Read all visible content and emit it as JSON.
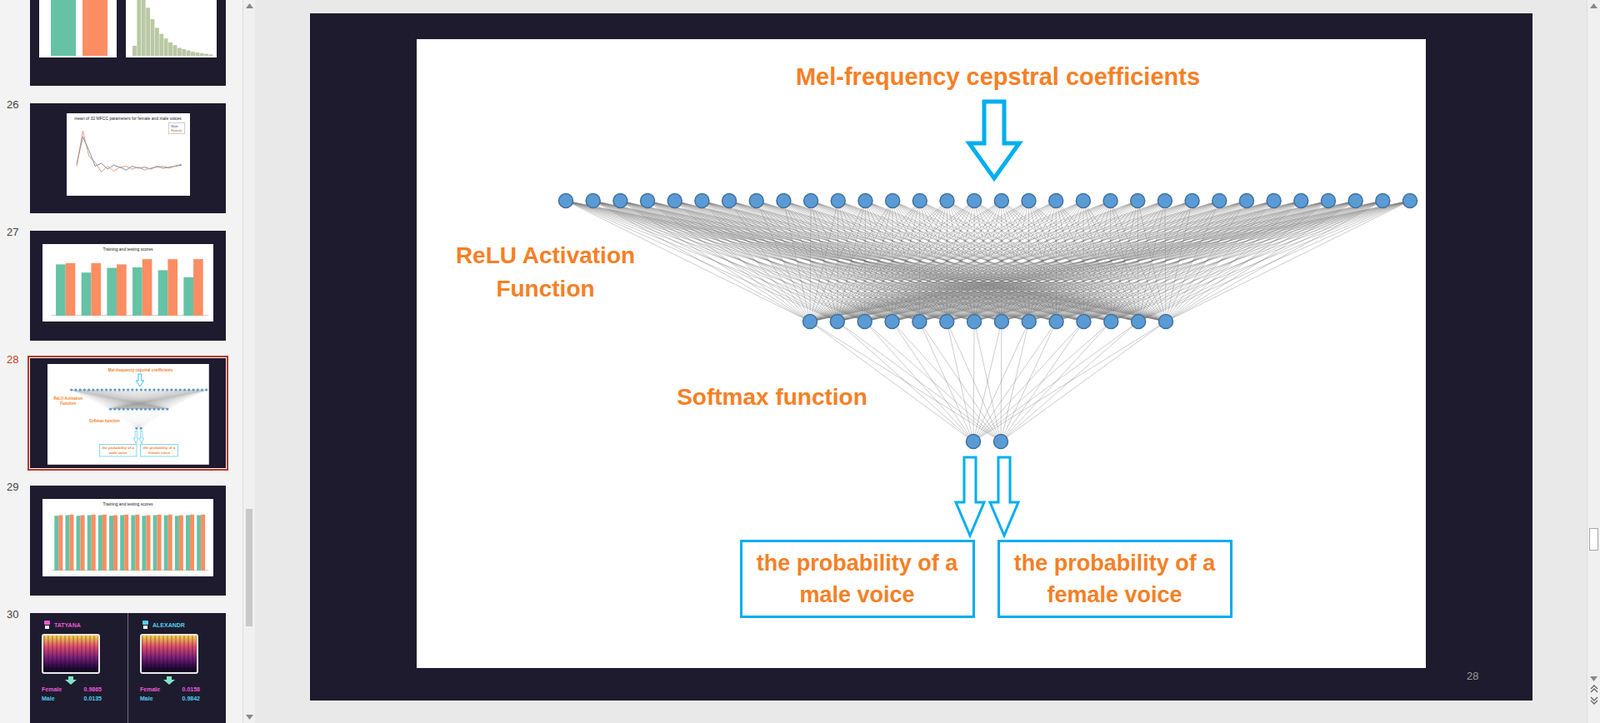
{
  "sidebar": {
    "slides": [
      {
        "number": "",
        "selected": false,
        "kind": "bars-hist",
        "bars": [
          0.95,
          0.92
        ],
        "hist": [
          0.15,
          0.85,
          0.95,
          0.72,
          0.55,
          0.42,
          0.33,
          0.26,
          0.2,
          0.16,
          0.12,
          0.1,
          0.08,
          0.06,
          0.05,
          0.04,
          0.03,
          0.02
        ]
      },
      {
        "number": "26",
        "selected": false,
        "kind": "lines",
        "title": "mean of 32 MFCC parameters for female and male voices",
        "legend": [
          "Male",
          "Female"
        ],
        "series": [
          [
            0.2,
            1.6,
            0.9,
            0.1,
            0.25,
            -0.05,
            0.15,
            0.05,
            -0.1,
            0.1,
            0.0,
            0.05,
            -0.05,
            0.1,
            0.0,
            0.05,
            0.1,
            0.15
          ],
          [
            0.1,
            1.9,
            0.6,
            0.3,
            -0.2,
            0.1,
            -0.15,
            0.05,
            0.1,
            -0.05,
            0.05,
            -0.1,
            0.0,
            0.05,
            0.1,
            0.0,
            0.12,
            0.2
          ]
        ]
      },
      {
        "number": "27",
        "selected": false,
        "kind": "bars",
        "title": "Training and testing scores",
        "series": [
          [
            0.88,
            0.74,
            0.82,
            0.83,
            0.78,
            0.66
          ],
          [
            0.9,
            0.9,
            0.88,
            0.97,
            0.97,
            0.97
          ]
        ]
      },
      {
        "number": "28",
        "selected": true,
        "kind": "diagram"
      },
      {
        "number": "29",
        "selected": false,
        "kind": "bars",
        "title": "Training and testing scores",
        "series": [
          [
            0.94,
            0.95,
            0.94,
            0.95,
            0.95,
            0.94,
            0.95,
            0.95,
            0.94,
            0.95,
            0.95,
            0.94,
            0.95,
            0.95
          ],
          [
            0.95,
            0.96,
            0.95,
            0.96,
            0.96,
            0.95,
            0.96,
            0.96,
            0.95,
            0.96,
            0.96,
            0.95,
            0.96,
            0.96
          ]
        ]
      },
      {
        "number": "30",
        "selected": false,
        "kind": "speakers",
        "speakers": [
          {
            "name": "TATYANA",
            "color": "#e85ad6",
            "scores": [
              {
                "label": "Female",
                "value": "0.9865",
                "color": "#e85ad6"
              },
              {
                "label": "Male",
                "value": "0.0135",
                "color": "#4fd0f0"
              }
            ]
          },
          {
            "name": "ALEXANDR",
            "color": "#4fd0f0",
            "scores": [
              {
                "label": "Female",
                "value": "0.0158",
                "color": "#e85ad6"
              },
              {
                "label": "Male",
                "value": "0.9842",
                "color": "#4fd0f0"
              }
            ]
          }
        ]
      }
    ]
  },
  "slide": {
    "number": "28",
    "title": "Mel-frequency cepstral coefficients",
    "hidden_label": "ReLU Activation Function",
    "output_label": "Softmax function",
    "layers": [
      {
        "nodes": 32
      },
      {
        "nodes": 14
      },
      {
        "nodes": 2
      }
    ],
    "outputs": [
      "the probability of a male voice",
      "the probability of a female voice"
    ]
  }
}
